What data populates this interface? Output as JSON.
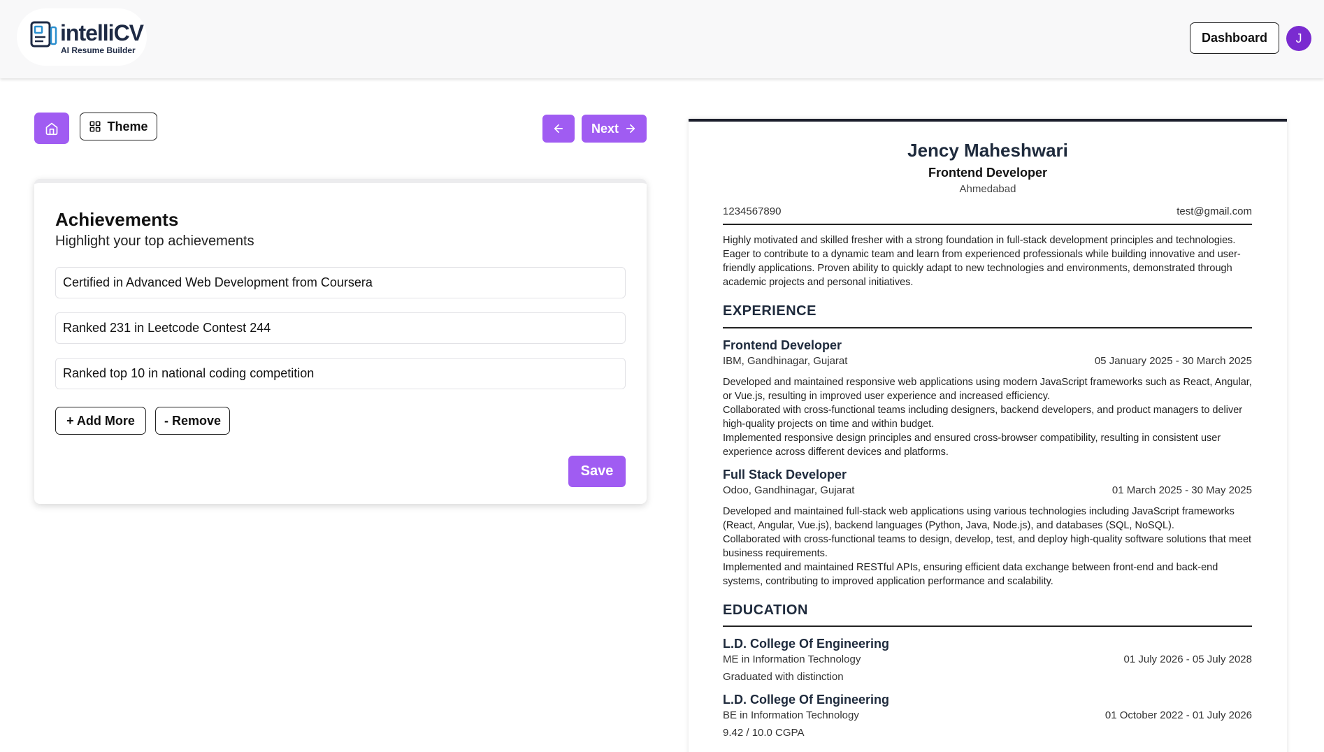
{
  "app": {
    "logo_name": "intelliCV",
    "logo_tagline": "AI Resume Builder",
    "dashboard_label": "Dashboard",
    "avatar_initial": "J",
    "accent_color": "#a05cf2"
  },
  "toolbar": {
    "theme_label": "Theme",
    "next_label": "Next"
  },
  "form": {
    "title": "Achievements",
    "subtitle": "Highlight your top achievements",
    "achievements": [
      "Certified in Advanced Web Development from Coursera",
      "Ranked 231 in Leetcode Contest 244",
      "Ranked top 10 in national coding competition"
    ],
    "add_more_label": "+ Add More",
    "remove_label": "- Remove",
    "save_label": "Save"
  },
  "resume": {
    "name": "Jency Maheshwari",
    "title": "Frontend Developer",
    "city": "Ahmedabad",
    "phone": "1234567890",
    "email": "test@gmail.com",
    "summary": "Highly motivated and skilled fresher with a strong foundation in full-stack development principles and technologies. Eager to contribute to a dynamic team and learn from experienced professionals while building innovative and user-friendly applications. Proven ability to quickly adapt to new technologies and environments, demonstrated through academic projects and personal initiatives.",
    "experience_heading": "EXPERIENCE",
    "experience": [
      {
        "role": "Frontend Developer",
        "company": "IBM, Gandhinagar, Gujarat",
        "dates": "05 January 2025 - 30 March 2025",
        "lines": [
          "Developed and maintained responsive web applications using modern JavaScript frameworks such as React, Angular, or Vue.js, resulting in improved user experience and increased efficiency.",
          "Collaborated with cross-functional teams including designers, backend developers, and product managers to deliver high-quality projects on time and within budget.",
          "Implemented responsive design principles and ensured cross-browser compatibility, resulting in consistent user experience across different devices and platforms."
        ]
      },
      {
        "role": "Full Stack Developer",
        "company": "Odoo, Gandhinagar, Gujarat",
        "dates": "01 March 2025 - 30 May 2025",
        "lines": [
          "Developed and maintained full-stack web applications using various technologies including JavaScript frameworks (React, Angular, Vue.js), backend languages (Python, Java, Node.js), and databases (SQL, NoSQL).",
          "Collaborated with cross-functional teams to design, develop, test, and deploy high-quality software solutions that meet business requirements.",
          "Implemented and maintained RESTful APIs, ensuring efficient data exchange between front-end and back-end systems, contributing to improved application performance and scalability."
        ]
      }
    ],
    "education_heading": "EDUCATION",
    "education": [
      {
        "school": "L.D. College Of Engineering",
        "degree": "ME in Information Technology",
        "dates": "01 July 2026 - 05 July 2028",
        "note": "Graduated with distinction"
      },
      {
        "school": "L.D. College Of Engineering",
        "degree": "BE in Information Technology",
        "dates": "01 October 2022 - 01 July 2026",
        "note": "9.42 / 10.0 CGPA"
      }
    ]
  }
}
